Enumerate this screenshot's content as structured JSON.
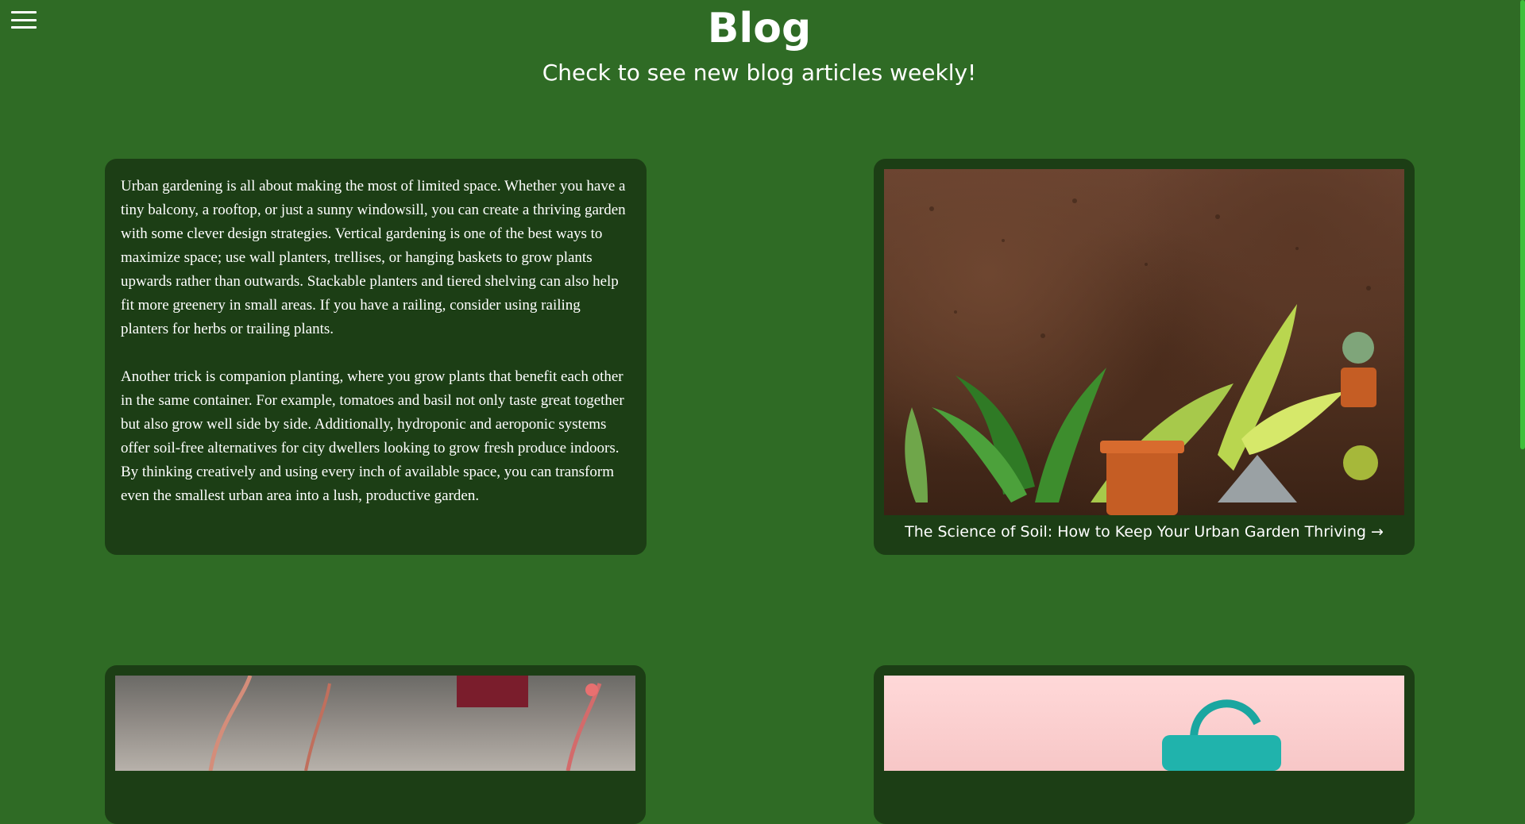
{
  "header": {
    "title": "Blog",
    "subtitle": "Check to see new blog articles weekly!"
  },
  "menu": {
    "icon": "hamburger-menu-icon"
  },
  "articles": {
    "intro_paragraphs": [
      "Urban gardening is all about making the most of limited space. Whether you have a tiny balcony, a rooftop, or just a sunny windowsill, you can create a thriving garden with some clever design strategies. Vertical gardening is one of the best ways to maximize space; use wall planters, trellises, or hanging baskets to grow plants upwards rather than outwards. Stackable planters and tiered shelving can also help fit more greenery in small areas. If you have a railing, consider using railing planters for herbs or trailing plants.",
      "Another trick is companion planting, where you grow plants that benefit each other in the same container. For example, tomatoes and basil not only taste great together but also grow well side by side. Additionally, hydroponic and aeroponic systems offer soil-free alternatives for city dwellers looking to grow fresh produce indoors. By thinking creatively and using every inch of available space, you can transform even the smallest urban area into a lush, productive garden."
    ],
    "featured_link": "The Science of Soil: How to Keep Your Urban Garden Thriving →"
  },
  "colors": {
    "background": "#2f6b25",
    "card": "#1c3e15",
    "scrollbar": "#3fbf3a"
  }
}
